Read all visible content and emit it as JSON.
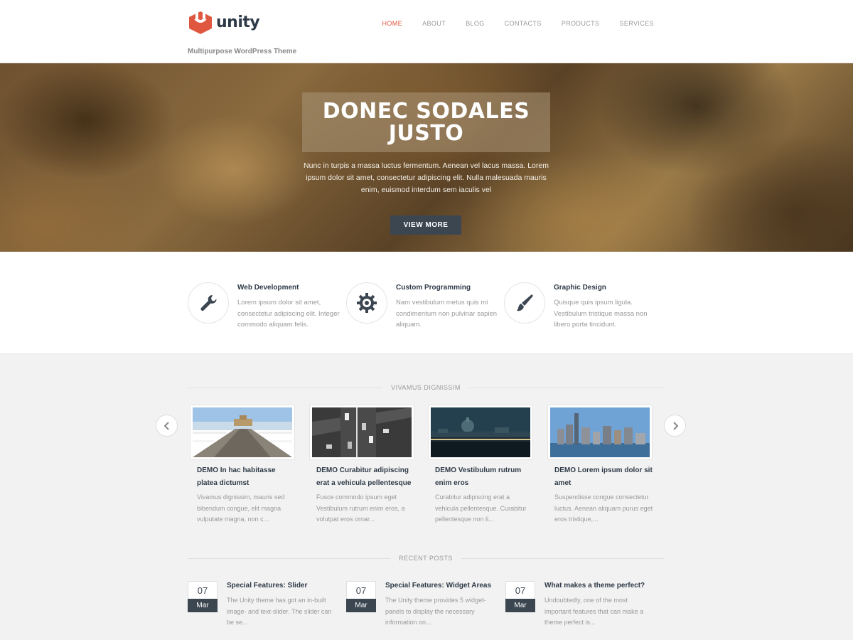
{
  "header": {
    "logo_text": "unity",
    "tagline": "Multipurpose WordPress Theme",
    "accent_color": "#e05740",
    "nav": [
      {
        "label": "HOME",
        "active": true
      },
      {
        "label": "ABOUT",
        "active": false
      },
      {
        "label": "BLOG",
        "active": false
      },
      {
        "label": "CONTACTS",
        "active": false
      },
      {
        "label": "PRODUCTS",
        "active": false
      },
      {
        "label": "SERVICES",
        "active": false
      }
    ]
  },
  "hero": {
    "title": "DONEC SODALES JUSTO",
    "text": "Nunc in turpis a massa luctus fermentum. Aenean vel lacus massa. Lorem ipsum dolor sit amet, consectetur adipiscing elit. Nulla malesuada mauris enim, euismod interdum sem iaculis vel",
    "button_label": "VIEW MORE"
  },
  "services": [
    {
      "icon": "wrench-icon",
      "title": "Web Development",
      "text": "Lorem ipsum dolor sit amet, consectetur adipiscing elit. Integer commodo aliquam felis."
    },
    {
      "icon": "gear-icon",
      "title": "Custom Programming",
      "text": "Nam vestibulum metus quis mi condimentum non pulvinar sapien aliquam."
    },
    {
      "icon": "paintbrush-icon",
      "title": "Graphic Design",
      "text": "Quisque quis ipsum ligula. Vestibulum tristique massa non libero porta tincidunt."
    }
  ],
  "portfolio": {
    "heading": "VIVAMUS DIGNISSIM",
    "items": [
      {
        "title": "DEMO In hac habitasse platea dictumst",
        "text": "Vivamus dignissim, mauris sed bibendum congue, elit magna vulputate magna, non c..."
      },
      {
        "title": "DEMO Curabitur adipiscing erat a vehicula pellentesque",
        "text": "Fusce commodo ipsum eget Vestibulum rutrum enim eros, a volutpat eros ornar..."
      },
      {
        "title": "DEMO Vestibulum rutrum enim eros",
        "text": "Curabitur adipiscing erat a vehicula pellentesque. Curabitur pellentesque non li..."
      },
      {
        "title": "DEMO Lorem ipsum dolor sit amet",
        "text": "Suspendisse congue consectetur luctus. Aenean aliquam purus eget eros tristique,..."
      }
    ]
  },
  "recent_posts": {
    "heading": "RECENT POSTS",
    "items": [
      {
        "day": "07",
        "month": "Mar",
        "title": "Special Features: Slider",
        "text": "The Unity theme has got an in-built image- and text-slider. The slider can be se..."
      },
      {
        "day": "07",
        "month": "Mar",
        "title": "Special Features: Widget Areas",
        "text": "The Unity theme provides 5 widget-panels to display the necessary information on..."
      },
      {
        "day": "07",
        "month": "Mar",
        "title": "What makes a theme perfect?",
        "text": "Undoubtedly, one of the most important features that can make a theme perfect is..."
      }
    ]
  }
}
